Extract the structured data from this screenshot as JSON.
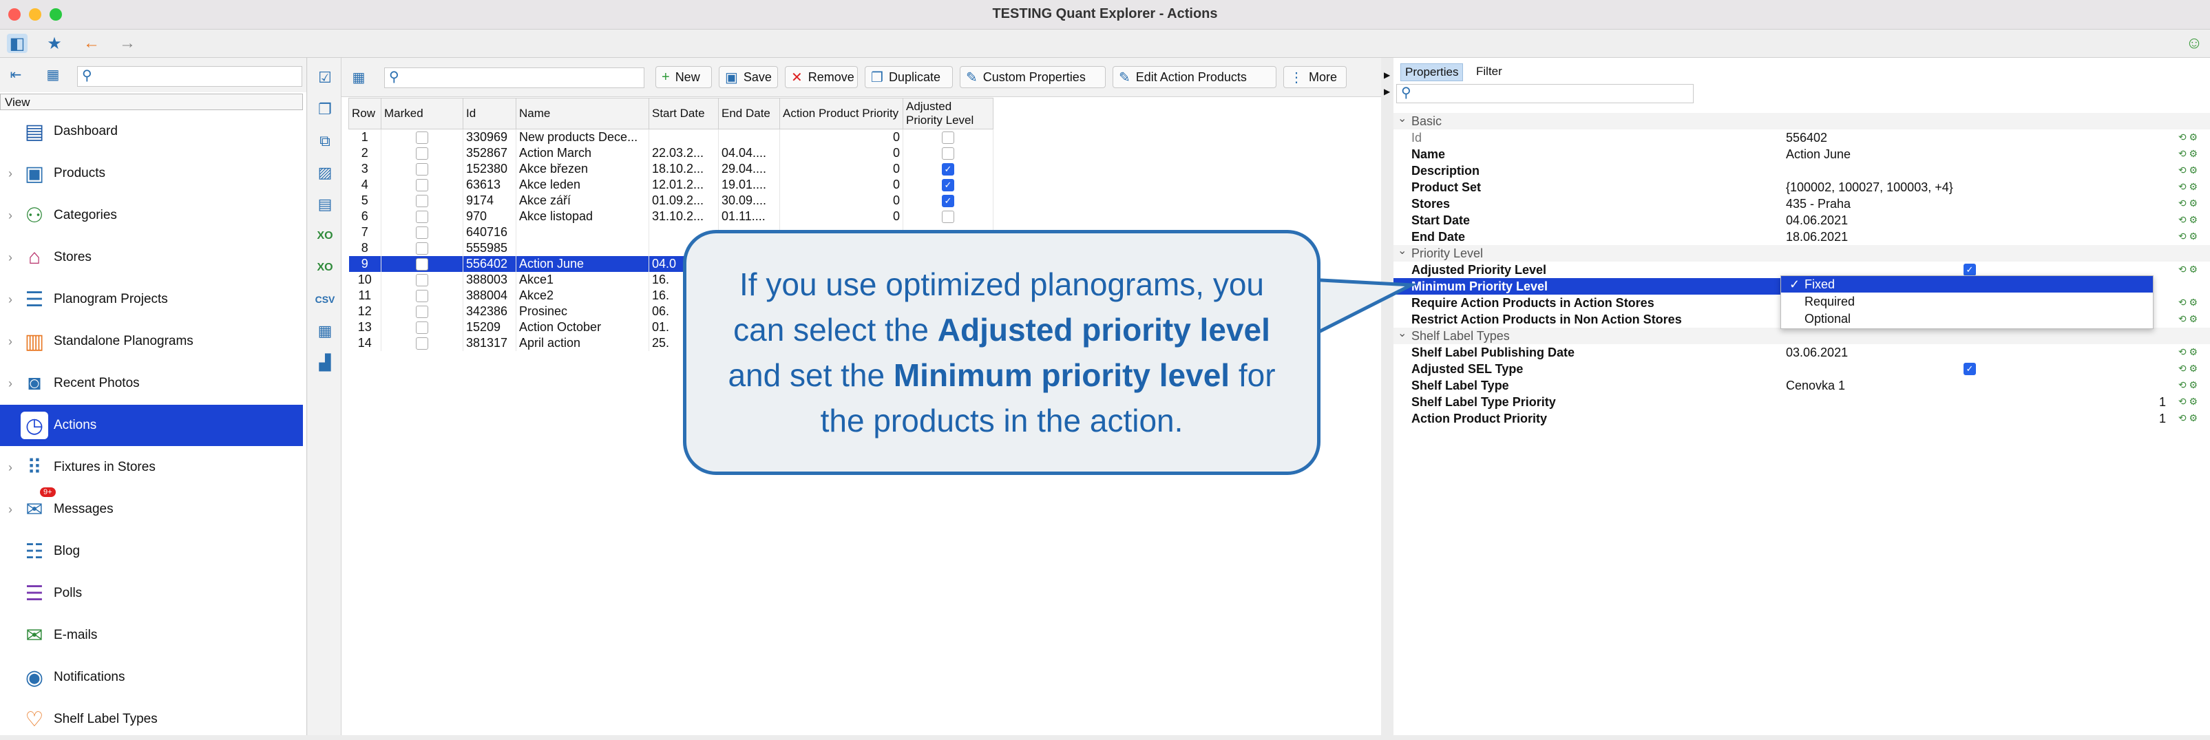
{
  "window": {
    "title": "TESTING Quant Explorer - Actions"
  },
  "left": {
    "view_label": "View",
    "nav": [
      {
        "label": "Dashboard",
        "icon": "dashboard-icon",
        "glyph": "▤"
      },
      {
        "label": "Products",
        "icon": "products-icon",
        "glyph": "▣"
      },
      {
        "label": "Categories",
        "icon": "categories-icon",
        "glyph": "⚇"
      },
      {
        "label": "Stores",
        "icon": "stores-icon",
        "glyph": "⌂"
      },
      {
        "label": "Planogram Projects",
        "icon": "planogram-projects-icon",
        "glyph": "☰"
      },
      {
        "label": "Standalone Planograms",
        "icon": "standalone-planograms-icon",
        "glyph": "▥"
      },
      {
        "label": "Recent Photos",
        "icon": "camera-icon",
        "glyph": "◙"
      },
      {
        "label": "Actions",
        "icon": "actions-clock-icon",
        "glyph": "◷"
      },
      {
        "label": "Fixtures in Stores",
        "icon": "fixtures-icon",
        "glyph": "⠿"
      },
      {
        "label": "Messages",
        "icon": "messages-icon",
        "glyph": "✉",
        "badge": "9+"
      },
      {
        "label": "Blog",
        "icon": "blog-icon",
        "glyph": "☷"
      },
      {
        "label": "Polls",
        "icon": "polls-icon",
        "glyph": "☰"
      },
      {
        "label": "E-mails",
        "icon": "email-icon",
        "glyph": "✉"
      },
      {
        "label": "Notifications",
        "icon": "notifications-icon",
        "glyph": "◉"
      },
      {
        "label": "Shelf Label Types",
        "icon": "shelf-label-types-icon",
        "glyph": "♡"
      }
    ]
  },
  "toolbar": {
    "new": "New",
    "save": "Save",
    "remove": "Remove",
    "duplicate": "Duplicate",
    "custom_properties": "Custom Properties",
    "edit_action_products": "Edit Action Products",
    "more": "More"
  },
  "grid": {
    "headers": [
      "Row",
      "Marked",
      "Id",
      "Name",
      "Start Date",
      "End Date",
      "Action Product Priority",
      "Adjusted Priority Level"
    ],
    "rows": [
      {
        "row": "1",
        "id": "330969",
        "name": "New products Dece...",
        "start": "",
        "end": "",
        "priority": "0",
        "adjusted": "empty"
      },
      {
        "row": "2",
        "id": "352867",
        "name": "Action March",
        "start": "22.03.2...",
        "end": "04.04....",
        "priority": "0",
        "adjusted": "empty"
      },
      {
        "row": "3",
        "id": "152380",
        "name": "Akce březen",
        "start": "18.10.2...",
        "end": "29.04....",
        "priority": "0",
        "adjusted": "checked"
      },
      {
        "row": "4",
        "id": "63613",
        "name": "Akce leden",
        "start": "12.01.2...",
        "end": "19.01....",
        "priority": "0",
        "adjusted": "checked"
      },
      {
        "row": "5",
        "id": "9174",
        "name": "Akce září",
        "start": "01.09.2...",
        "end": "30.09....",
        "priority": "0",
        "adjusted": "checked"
      },
      {
        "row": "6",
        "id": "970",
        "name": "Akce listopad",
        "start": "31.10.2...",
        "end": "01.11....",
        "priority": "0",
        "adjusted": "empty"
      },
      {
        "row": "7",
        "id": "640716",
        "name": "",
        "start": "",
        "end": "",
        "priority": "",
        "adjusted": "none"
      },
      {
        "row": "8",
        "id": "555985",
        "name": "",
        "start": "",
        "end": "",
        "priority": "",
        "adjusted": "none"
      },
      {
        "row": "9",
        "id": "556402",
        "name": "Action June",
        "start": "04.0",
        "end": "",
        "priority": "",
        "adjusted": "none",
        "selected": true
      },
      {
        "row": "10",
        "id": "388003",
        "name": "Akce1",
        "start": "16.",
        "end": "",
        "priority": "",
        "adjusted": "none"
      },
      {
        "row": "11",
        "id": "388004",
        "name": "Akce2",
        "start": "16.",
        "end": "",
        "priority": "",
        "adjusted": "none"
      },
      {
        "row": "12",
        "id": "342386",
        "name": "Prosinec",
        "start": "06.",
        "end": "",
        "priority": "",
        "adjusted": "none"
      },
      {
        "row": "13",
        "id": "15209",
        "name": "Action October",
        "start": "01.",
        "end": "",
        "priority": "",
        "adjusted": "none"
      },
      {
        "row": "14",
        "id": "381317",
        "name": "April action",
        "start": "25.",
        "end": "",
        "priority": "",
        "adjusted": "none"
      }
    ]
  },
  "properties": {
    "tabs": [
      "Properties",
      "Filter"
    ],
    "sections": [
      {
        "title": "Basic",
        "rows": [
          {
            "name": "Id",
            "value": "556402",
            "bold": false
          },
          {
            "name": "Name",
            "value": "Action June",
            "bold": true
          },
          {
            "name": "Description",
            "value": "",
            "bold": true
          },
          {
            "name": "Product Set",
            "value": "{100002, 100027, 100003, +4}",
            "bold": true
          },
          {
            "name": "Stores",
            "value": "435 - Praha",
            "bold": true
          },
          {
            "name": "Start Date",
            "value": "04.06.2021",
            "bold": true
          },
          {
            "name": "End Date",
            "value": "18.06.2021",
            "bold": true
          }
        ]
      },
      {
        "title": "Priority Level",
        "rows": [
          {
            "name": "Adjusted Priority Level",
            "value": "",
            "check": true
          },
          {
            "name": "Minimum Priority Level",
            "value": "",
            "selected": true
          },
          {
            "name": "Require Action Products in Action Stores",
            "value": ""
          },
          {
            "name": "Restrict Action Products in Non Action Stores",
            "value": ""
          }
        ]
      },
      {
        "title": "Shelf Label Types",
        "rows": [
          {
            "name": "Shelf Label Publishing Date",
            "value": "03.06.2021"
          },
          {
            "name": "Adjusted SEL Type",
            "value": "",
            "check": true
          },
          {
            "name": "Shelf Label Type",
            "value": "Cenovka 1"
          },
          {
            "name": "Shelf Label Type Priority",
            "value": "1",
            "right": true
          },
          {
            "name": "Action Product Priority",
            "value": "1",
            "right": true
          }
        ]
      }
    ],
    "dropdown": [
      "Fixed",
      "Required",
      "Optional"
    ]
  },
  "callout": {
    "t1": "If you use optimized planograms, you can select the ",
    "b1": "Adjusted priority level",
    "t2": " and set the ",
    "b2": "Minimum priority level",
    "t3": " for the products in the action."
  }
}
